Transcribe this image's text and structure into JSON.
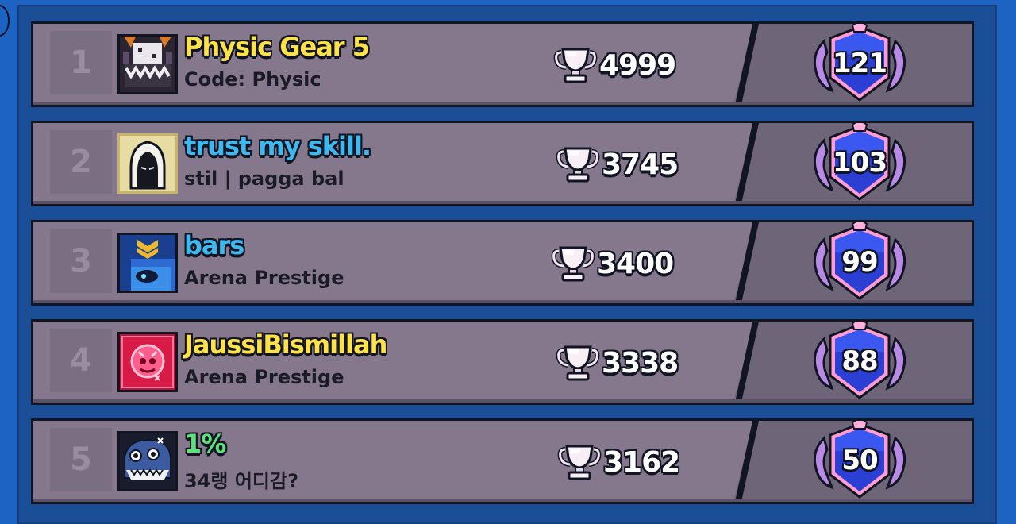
{
  "leaderboard": [
    {
      "rank": "1",
      "name": "Physic Gear 5",
      "name_color": "#ffe14a",
      "subtitle": "Code: Physic",
      "trophies": "4999",
      "level": "121",
      "avatar_icon": "cube-monster-avatar-icon"
    },
    {
      "rank": "2",
      "name": "trust my skill.",
      "name_color": "#3fb8f0",
      "subtitle": "stil | pagga bal",
      "trophies": "3745",
      "level": "103",
      "avatar_icon": "hooded-figure-avatar-icon"
    },
    {
      "rank": "3",
      "name": "bars",
      "name_color": "#3fb8f0",
      "subtitle": "Arena Prestige",
      "trophies": "3400",
      "level": "99",
      "avatar_icon": "helmet-brawler-avatar-icon"
    },
    {
      "rank": "4",
      "name": "JaussiBismillah",
      "name_color": "#ffe14a",
      "subtitle": "Arena Prestige",
      "trophies": "3338",
      "level": "88",
      "avatar_icon": "pink-skull-avatar-icon"
    },
    {
      "rank": "5",
      "name": "1%",
      "name_color": "#5ee07a",
      "subtitle": "34랭 어디감?",
      "trophies": "3162",
      "level": "50",
      "avatar_icon": "shark-brawler-avatar-icon"
    }
  ],
  "icons": {
    "trophy": "trophy-icon",
    "level": "level-badge-icon",
    "back": "back-button-icon"
  }
}
